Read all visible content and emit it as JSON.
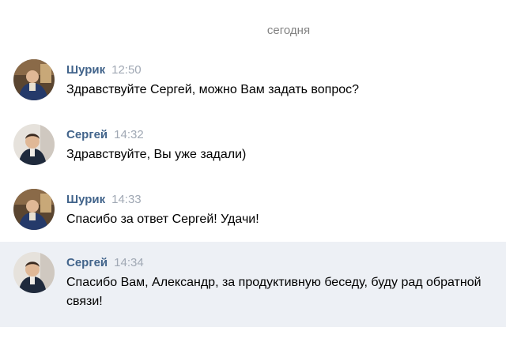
{
  "date_separator": "сегодня",
  "messages": [
    {
      "author": "Шурик",
      "time": "12:50",
      "text": "Здравствуйте Сергей, можно Вам задать вопрос?",
      "avatar": "avatar-shurik"
    },
    {
      "author": "Сергей",
      "time": "14:32",
      "text": "Здравствуйте, Вы уже задали)",
      "avatar": "avatar-sergey"
    },
    {
      "author": "Шурик",
      "time": "14:33",
      "text": "Спасибо за ответ Сергей! Удачи!",
      "avatar": "avatar-shurik"
    },
    {
      "author": "Сергей",
      "time": "14:34",
      "text": "Спасибо Вам, Александр, за продуктивную беседу, буду рад обратной связи!",
      "avatar": "avatar-sergey",
      "highlighted": true
    }
  ],
  "colors": {
    "author": "#42648b",
    "time": "#a0a8b4",
    "highlight_bg": "#edf0f5",
    "date_separator": "#828282"
  }
}
